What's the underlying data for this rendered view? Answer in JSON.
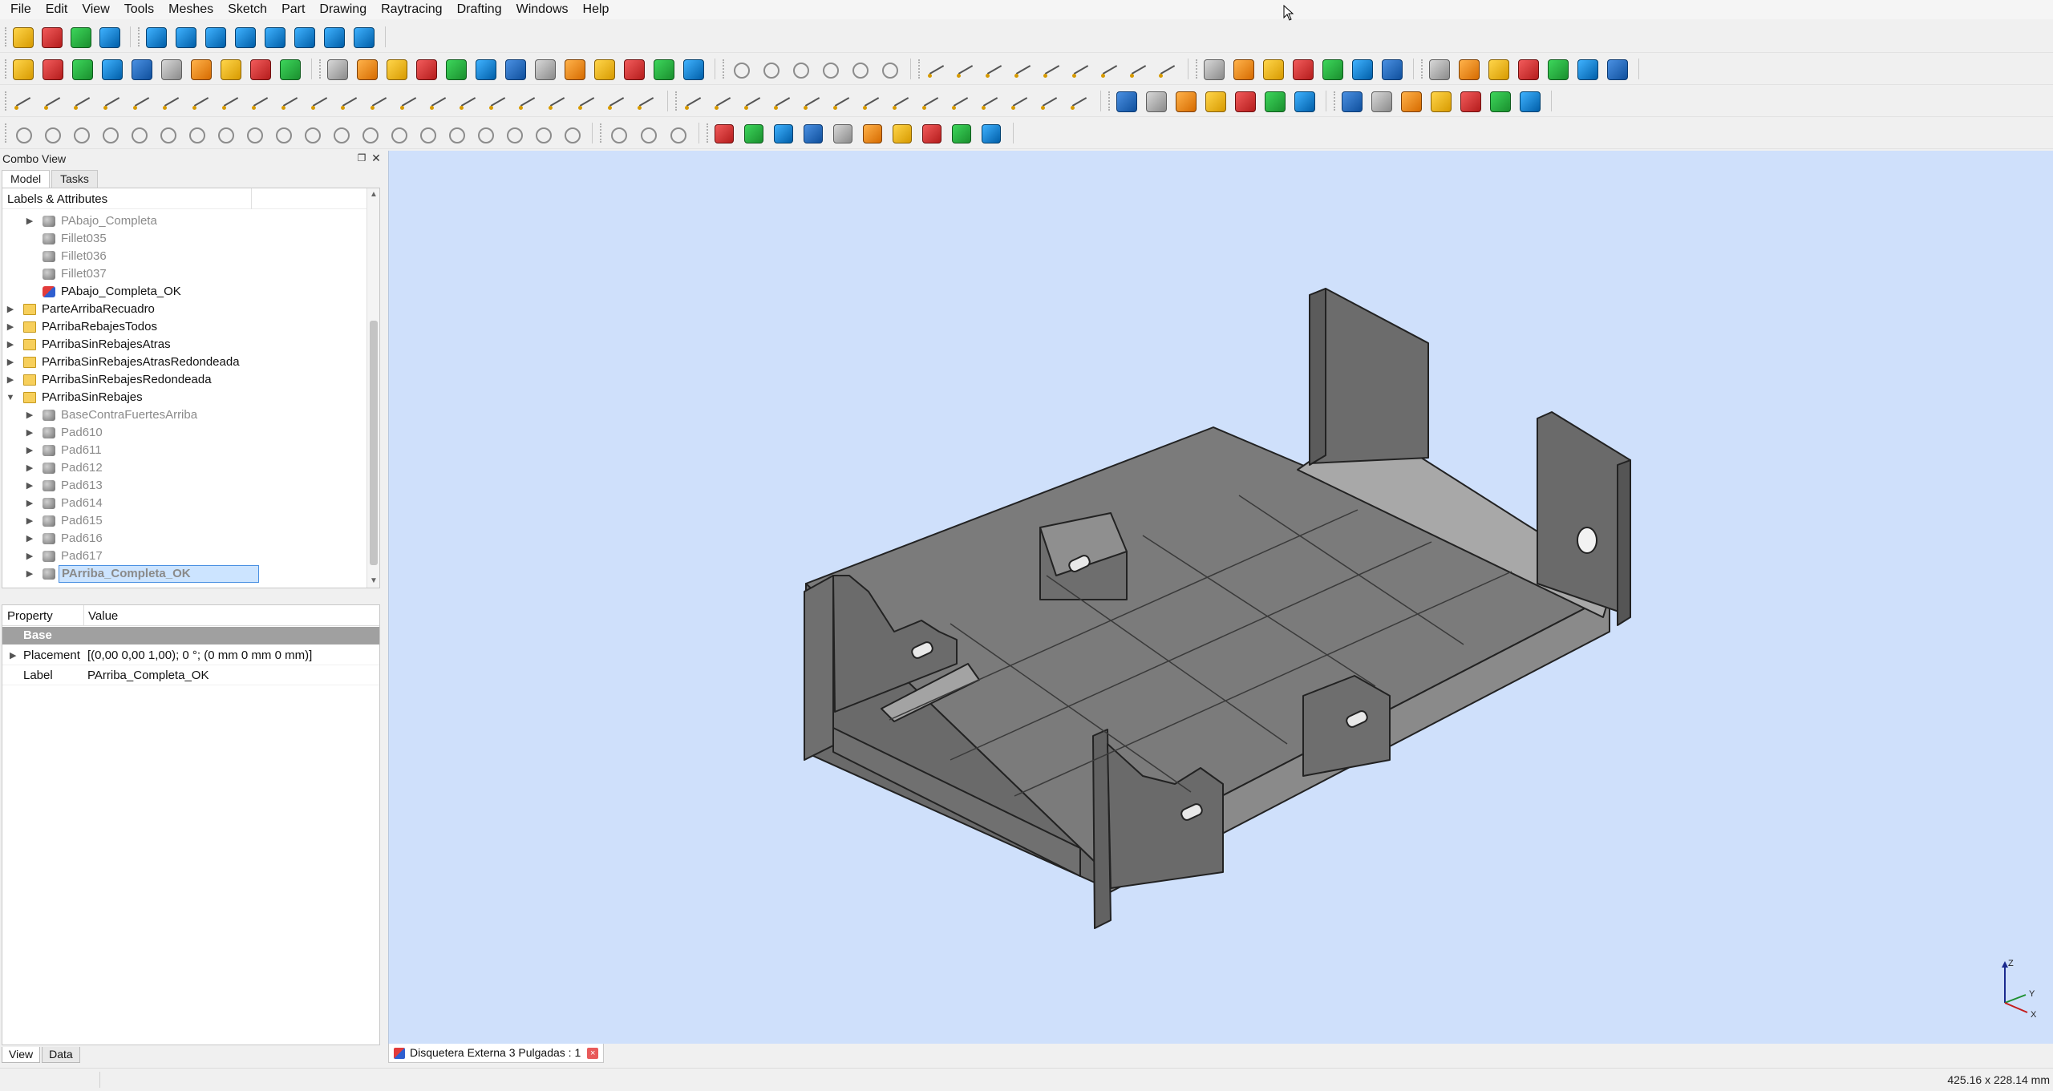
{
  "menu": [
    "File",
    "Edit",
    "View",
    "Tools",
    "Meshes",
    "Sketch",
    "Part",
    "Drawing",
    "Raytracing",
    "Drafting",
    "Windows",
    "Help"
  ],
  "combo": {
    "title": "Combo View",
    "tabs": [
      "Model",
      "Tasks"
    ],
    "tree_header": "Labels & Attributes",
    "tree_items": [
      {
        "label": "PAbajo_Completa",
        "indent": 2,
        "expander": "collapsed",
        "icon": "shape",
        "state": "dim"
      },
      {
        "label": "Fillet035",
        "indent": 2,
        "expander": "none",
        "icon": "shape",
        "state": "dim"
      },
      {
        "label": "Fillet036",
        "indent": 2,
        "expander": "none",
        "icon": "shape",
        "state": "dim"
      },
      {
        "label": "Fillet037",
        "indent": 2,
        "expander": "none",
        "icon": "shape",
        "state": "dim"
      },
      {
        "label": "PAbajo_Completa_OK",
        "indent": 2,
        "expander": "none",
        "icon": "body",
        "state": "normal"
      },
      {
        "label": "ParteArribaRecuadro",
        "indent": 1,
        "expander": "collapsed",
        "icon": "folder",
        "state": "normal"
      },
      {
        "label": "PArribaRebajesTodos",
        "indent": 1,
        "expander": "collapsed",
        "icon": "folder",
        "state": "normal"
      },
      {
        "label": "PArribaSinRebajesAtras",
        "indent": 1,
        "expander": "collapsed",
        "icon": "folder",
        "state": "normal"
      },
      {
        "label": "PArribaSinRebajesAtrasRedondeada",
        "indent": 1,
        "expander": "collapsed",
        "icon": "folder",
        "state": "normal"
      },
      {
        "label": "PArribaSinRebajesRedondeada",
        "indent": 1,
        "expander": "collapsed",
        "icon": "folder",
        "state": "normal"
      },
      {
        "label": "PArribaSinRebajes",
        "indent": 1,
        "expander": "expanded",
        "icon": "folder",
        "state": "normal"
      },
      {
        "label": "BaseContraFuertesArriba",
        "indent": 2,
        "expander": "collapsed",
        "icon": "shape",
        "state": "dim"
      },
      {
        "label": "Pad610",
        "indent": 2,
        "expander": "collapsed",
        "icon": "shape",
        "state": "dim"
      },
      {
        "label": "Pad611",
        "indent": 2,
        "expander": "collapsed",
        "icon": "shape",
        "state": "dim"
      },
      {
        "label": "Pad612",
        "indent": 2,
        "expander": "collapsed",
        "icon": "shape",
        "state": "dim"
      },
      {
        "label": "Pad613",
        "indent": 2,
        "expander": "collapsed",
        "icon": "shape",
        "state": "dim"
      },
      {
        "label": "Pad614",
        "indent": 2,
        "expander": "collapsed",
        "icon": "shape",
        "state": "dim"
      },
      {
        "label": "Pad615",
        "indent": 2,
        "expander": "collapsed",
        "icon": "shape",
        "state": "dim"
      },
      {
        "label": "Pad616",
        "indent": 2,
        "expander": "collapsed",
        "icon": "shape",
        "state": "dim"
      },
      {
        "label": "Pad617",
        "indent": 2,
        "expander": "collapsed",
        "icon": "shape",
        "state": "dim"
      },
      {
        "label": "PArriba_Completa_OK",
        "indent": 2,
        "expander": "collapsed",
        "icon": "shape",
        "state": "selected"
      }
    ],
    "property_headers": {
      "property": "Property",
      "value": "Value"
    },
    "property_group": "Base",
    "properties": [
      {
        "name": "Placement",
        "value": "[(0,00 0,00 1,00); 0 °; (0 mm  0 mm  0 mm)]",
        "expandable": true
      },
      {
        "name": "Label",
        "value": "PArriba_Completa_OK",
        "expandable": false
      }
    ],
    "view_tabs": [
      "View",
      "Data"
    ]
  },
  "document_tab": {
    "title": "Disquetera Externa 3 Pulgadas : 1",
    "close": "×"
  },
  "status": {
    "dimensions": "425.16 x 228.14 mm"
  },
  "axis": {
    "x": "X",
    "y": "Y",
    "z": "Z"
  },
  "colors": {
    "viewport_bg": "#cfe0fb",
    "model_face": "#7a7a7a",
    "selection": "#cce4ff"
  }
}
